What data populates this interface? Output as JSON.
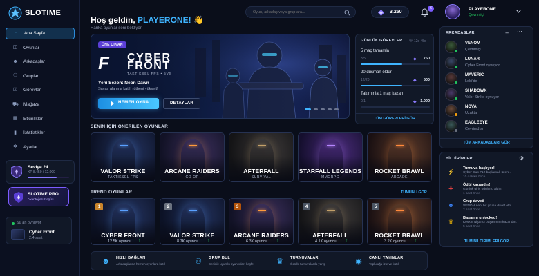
{
  "brand": {
    "name": "SLOTIME"
  },
  "search": {
    "placeholder": "Oyun, arkadaş veya grup ara..."
  },
  "header": {
    "coins": "3.250",
    "notif_count": "6",
    "user_name": "PLAYERONE",
    "user_status": "Çevrimiçi"
  },
  "nav": {
    "items": [
      {
        "label": "Ana Sayfa",
        "icon": "home-icon"
      },
      {
        "label": "Oyunlar",
        "icon": "gamepad-icon"
      },
      {
        "label": "Arkadaşlar",
        "icon": "users-icon"
      },
      {
        "label": "Gruplar",
        "icon": "group-icon"
      },
      {
        "label": "Görevler",
        "icon": "tasks-icon"
      },
      {
        "label": "Mağaza",
        "icon": "cart-icon"
      },
      {
        "label": "Etkinlikler",
        "icon": "calendar-icon"
      },
      {
        "label": "İstatistikler",
        "icon": "stats-icon"
      },
      {
        "label": "Ayarlar",
        "icon": "gear-icon"
      }
    ]
  },
  "level": {
    "label": "Seviye 24",
    "xp": "XP 8.450 / 12.000",
    "progress": 0.7
  },
  "pro": {
    "title": "SLOTIME PRO",
    "sub": "Avantajları Keşfet"
  },
  "now_playing": {
    "label": "Şu an oynuyor",
    "game": "Cyber Front",
    "time": "2.4 saat"
  },
  "welcome": {
    "greeting": "Hoş geldin,",
    "user": "PLAYERONE!",
    "wave": "👋",
    "sub": "Harika oyunlar seni bekliyor"
  },
  "hero": {
    "badge": "ÖNE ÇIKAN",
    "logo_mark": "F",
    "title_line1": "CYBER",
    "title_line2": "FRONT",
    "tagline": "TAKTİKSEL FPS • 5VS",
    "season": "Yeni Sezon: Neon Dawn",
    "desc": "Savaş alanına katıl, rütbeni yükselt!",
    "play": "HEMEN OYNA",
    "details": "DETAYLAR"
  },
  "quests": {
    "title": "GÜNLÜK GÖREVLER",
    "timer": "12s 45d",
    "items": [
      {
        "name": "5 maç tamamla",
        "progress_text": "3/5",
        "progress": 0.6,
        "reward": "750"
      },
      {
        "name": "20 düşman öldür",
        "progress_text": "12/20",
        "progress": 0.6,
        "reward": "500"
      },
      {
        "name": "Takımınla 1 maç kazan",
        "progress_text": "0/1",
        "progress": 0.0,
        "reward": "1.000"
      }
    ],
    "view_all": "TÜM GÖREVLERİ GÖR"
  },
  "recommended": {
    "title": "SENİN İÇİN ÖNERİLEN OYUNLAR",
    "games": [
      {
        "title": "VALOR STRIKE",
        "genre": "TAKTİKSEL FPS"
      },
      {
        "title": "ARCANE RAIDERS",
        "genre": "CO-OP"
      },
      {
        "title": "AFTERFALL",
        "genre": "SURVIVAL"
      },
      {
        "title": "STARFALL LEGENDS",
        "genre": "MMORPG"
      },
      {
        "title": "ROCKET BRAWL",
        "genre": "ARCADE"
      }
    ]
  },
  "trending": {
    "title": "TREND OYUNLAR",
    "view_all": "TÜMÜNÜ GÖR",
    "games": [
      {
        "rank": "1",
        "title": "CYBER FRONT",
        "players": "12.5K oyuncu"
      },
      {
        "rank": "2",
        "title": "VALOR STRIKE",
        "players": "8.7K oyuncu"
      },
      {
        "rank": "3",
        "title": "ARCANE RAIDERS",
        "players": "6.3K oyuncu"
      },
      {
        "rank": "4",
        "title": "AFTERFALL",
        "players": "4.1K oyuncu"
      },
      {
        "rank": "5",
        "title": "ROCKET BRAWL",
        "players": "3.2K oyuncu"
      }
    ]
  },
  "bottom": {
    "items": [
      {
        "title": "HIZLI BAĞLAN",
        "desc": "Arkadaşlarına hemen oyunlara katıl"
      },
      {
        "title": "GRUP BUL",
        "desc": "Seninle uyumlu oyuncuları keşfet"
      },
      {
        "title": "TURNUVALAR",
        "desc": "Ödüllü turnuvalarda yarış"
      },
      {
        "title": "CANLI YAYINLAR",
        "desc": "Topluluğu izle ve katıl"
      }
    ]
  },
  "friends": {
    "title": "ARKADAŞLAR",
    "list": [
      {
        "name": "VENOM",
        "status": "Çevrimiçi",
        "color": "#22c55e"
      },
      {
        "name": "LUNAR",
        "status": "Cyber Front oynuyor",
        "color": "#22c55e"
      },
      {
        "name": "MAVERIC",
        "status": "Lobi'de",
        "color": "#22c55e"
      },
      {
        "name": "SHADOWX",
        "status": "Valor Strike oynuyor",
        "color": "#22c55e"
      },
      {
        "name": "NOVA",
        "status": "Uzakta",
        "color": "#f59e0b"
      },
      {
        "name": "EAGLEEYE",
        "status": "Çevrimdışı",
        "color": "#6b7280"
      }
    ],
    "view_all": "TÜM ARKADAŞLARI GÖR"
  },
  "notifications": {
    "title": "BİLDİRİMLER",
    "list": [
      {
        "title": "Turnuva başlıyor!",
        "desc": "Cyber Cup #12 başlamak üzere.",
        "time": "10 dakika önce",
        "color": "#a855f7"
      },
      {
        "title": "Ödül kazandın!",
        "desc": "Günlük giriş ödülünü aldın.",
        "time": "1 saat önce",
        "color": "#ef4444"
      },
      {
        "title": "Grup daveti",
        "desc": "VENOM seni bir gruba davet etti.",
        "time": "2 saat önce",
        "color": "#3b82f6"
      },
      {
        "title": "Başarım unlocked!",
        "desc": "Keskin Nişancı başarımını kazandın.",
        "time": "5 saat önce",
        "color": "#eab308"
      }
    ],
    "view_all": "TÜM BİLDİRİMLERİ GÖR"
  }
}
